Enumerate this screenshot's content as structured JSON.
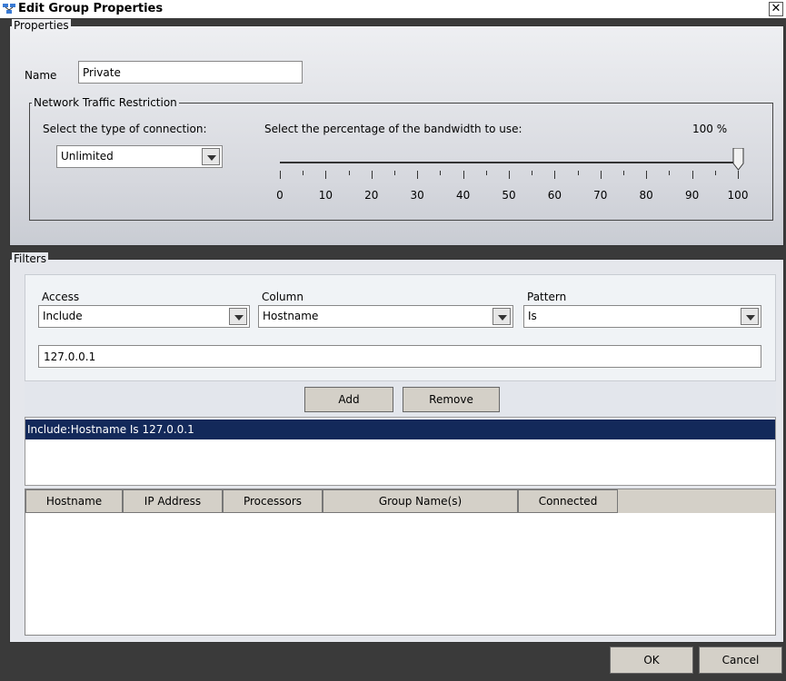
{
  "window": {
    "title": "Edit Group Properties",
    "close_glyph": "✕"
  },
  "properties": {
    "legend": "Properties",
    "name_label": "Name",
    "name_value": "Private",
    "network": {
      "legend": "Network Traffic Restriction",
      "connection_label": "Select the type of connection:",
      "connection_value": "Unlimited",
      "bandwidth_label": "Select the percentage of the bandwidth to use:",
      "bandwidth_value_text": "100 %",
      "bandwidth_percent": 100,
      "tick_labels": [
        "0",
        "10",
        "20",
        "30",
        "40",
        "50",
        "60",
        "70",
        "80",
        "90",
        "100"
      ]
    }
  },
  "filters": {
    "legend": "Filters",
    "access_label": "Access",
    "access_value": "Include",
    "column_label": "Column",
    "column_value": "Hostname",
    "pattern_label": "Pattern",
    "pattern_value": "Is",
    "value_input": "127.0.0.1",
    "add_label": "Add",
    "remove_label": "Remove",
    "list_items": [
      "Include:Hostname Is 127.0.0.1"
    ]
  },
  "host_table": {
    "columns": [
      "Hostname",
      "IP Address",
      "Processors",
      "Group Name(s)",
      "Connected"
    ]
  },
  "footer": {
    "ok_label": "OK",
    "cancel_label": "Cancel"
  },
  "colors": {
    "selection": "#13295a",
    "window_bg": "#3a3a3a"
  }
}
